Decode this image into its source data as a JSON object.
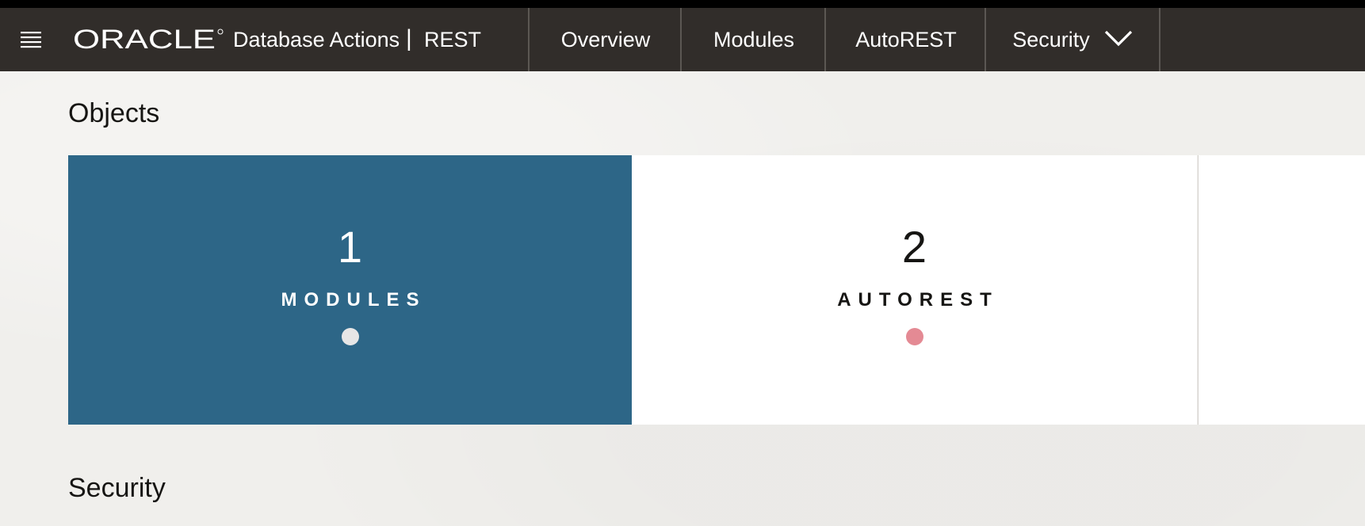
{
  "header": {
    "brand": "ORACLE",
    "app_name": "Database Actions",
    "separator": "|",
    "section": "REST",
    "nav": [
      {
        "label": "Overview"
      },
      {
        "label": "Modules"
      },
      {
        "label": "AutoREST"
      },
      {
        "label": "Security"
      }
    ],
    "nav_dropdown_icon": "chevron-down-icon",
    "menu_icon": "hamburger-icon"
  },
  "objects": {
    "title": "Objects",
    "cards": [
      {
        "count": "1",
        "label": "MODULES",
        "dot_color": "#e6e6e6",
        "background": "#2d6687"
      },
      {
        "count": "2",
        "label": "AUTOREST",
        "dot_color": "#e48a94",
        "background": "#ffffff"
      }
    ]
  },
  "security": {
    "title": "Security"
  },
  "colors": {
    "header_bg": "#312d2a",
    "page_bg": "#f0efec",
    "accent": "#2d6687"
  }
}
